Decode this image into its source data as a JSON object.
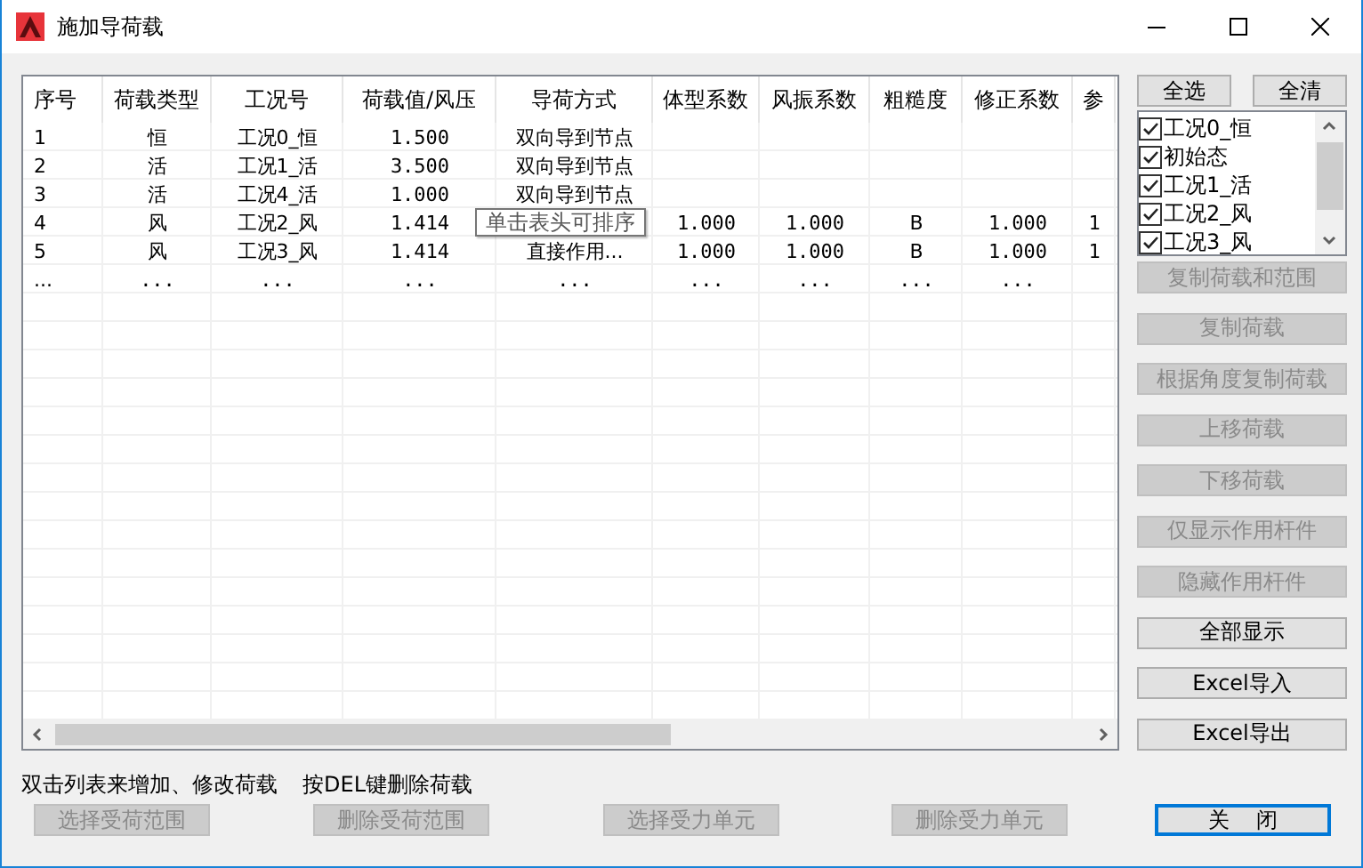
{
  "window": {
    "title": "施加导荷载"
  },
  "table": {
    "columns": [
      "序号",
      "荷载类型",
      "工况号",
      "荷载值/风压",
      "导荷方式",
      "体型系数",
      "风振系数",
      "粗糙度",
      "修正系数",
      "参"
    ],
    "rows": [
      {
        "cells": [
          "1",
          "恒",
          "工况0_恒",
          "1.500",
          "双向导到节点",
          null,
          null,
          null,
          null,
          null
        ]
      },
      {
        "cells": [
          "2",
          "活",
          "工况1_活",
          "3.500",
          "双向导到节点",
          null,
          null,
          null,
          null,
          null
        ]
      },
      {
        "cells": [
          "3",
          "活",
          "工况4_活",
          "1.000",
          "双向导到节点",
          null,
          null,
          null,
          null,
          null
        ]
      },
      {
        "cells": [
          "4",
          "风",
          "工况2_风",
          "1.414",
          null,
          "1.000",
          "1.000",
          "B",
          "1.000",
          "1"
        ]
      },
      {
        "cells": [
          "5",
          "风",
          "工况3_风",
          "1.414",
          "直接作用...",
          "1.000",
          "1.000",
          "B",
          "1.000",
          "1"
        ]
      },
      {
        "cells": [
          "...",
          "...",
          "...",
          "...",
          "...",
          "...",
          "...",
          "...",
          "...",
          null
        ]
      }
    ],
    "tooltip": "单击表头可排序"
  },
  "select_buttons": [
    "全选",
    "全清"
  ],
  "load_cases": [
    {
      "label": "工况0_恒",
      "checked": true
    },
    {
      "label": "初始态",
      "checked": true
    },
    {
      "label": "工况1_活",
      "checked": true
    },
    {
      "label": "工况2_风",
      "checked": true
    },
    {
      "label": "工况3_风",
      "checked": true
    }
  ],
  "side_buttons": [
    {
      "label": "复制荷载和范围",
      "disabled": true
    },
    {
      "label": "复制荷载",
      "disabled": true
    },
    {
      "label": "根据角度复制荷载",
      "disabled": true
    },
    {
      "label": "上移荷载",
      "disabled": true
    },
    {
      "label": "下移荷载",
      "disabled": true
    },
    {
      "label": "仅显示作用杆件",
      "disabled": true
    },
    {
      "label": "隐藏作用杆件",
      "disabled": true
    },
    {
      "label": "全部显示",
      "disabled": false
    },
    {
      "label": "Excel导入",
      "disabled": false
    },
    {
      "label": "Excel导出",
      "disabled": false
    }
  ],
  "hints": [
    "双击列表来增加、修改荷载",
    "按DEL键删除荷载"
  ],
  "bottom_buttons": [
    {
      "label": "选择受荷范围",
      "disabled": true,
      "default": false
    },
    {
      "label": "删除受荷范围",
      "disabled": true,
      "default": false
    },
    {
      "label": "选择受力单元",
      "disabled": true,
      "default": false
    },
    {
      "label": "删除受力单元",
      "disabled": true,
      "default": false
    },
    {
      "label": "关    闭",
      "disabled": false,
      "default": true
    }
  ]
}
